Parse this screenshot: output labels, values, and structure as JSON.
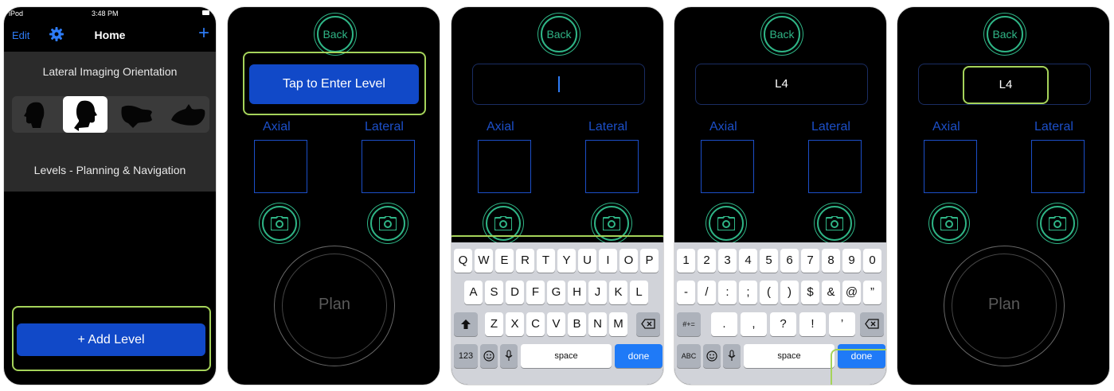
{
  "colors": {
    "accent_blue": "#1149c8",
    "link_blue": "#2e7cf6",
    "green": "#2fb586",
    "highlight": "#a5d35a",
    "label_blue": "#1c4fc8"
  },
  "screen1": {
    "status": {
      "carrier": "iPod",
      "time": "3:48 PM"
    },
    "nav": {
      "edit": "Edit",
      "title": "Home",
      "plus": "+",
      "settings_icon": "gear-icon"
    },
    "orientation_label": "Lateral Imaging Orientation",
    "orientation_options": [
      "head-left-icon",
      "head-right-icon",
      "head-down-icon",
      "head-up-icon"
    ],
    "orientation_selected": 2,
    "levels_label": "Levels - Planning & Navigation",
    "add_button": "+ Add Level"
  },
  "screen2": {
    "back": "Back",
    "tap_button": "Tap to Enter Level",
    "axial": "Axial",
    "lateral": "Lateral",
    "plan": "Plan"
  },
  "screen3": {
    "back": "Back",
    "axial": "Axial",
    "lateral": "Lateral",
    "keyboard": {
      "row1": [
        "Q",
        "W",
        "E",
        "R",
        "T",
        "Y",
        "U",
        "I",
        "O",
        "P"
      ],
      "row2": [
        "A",
        "S",
        "D",
        "F",
        "G",
        "H",
        "J",
        "K",
        "L"
      ],
      "row3": [
        "Z",
        "X",
        "C",
        "V",
        "B",
        "N",
        "M"
      ],
      "mode": "123",
      "space": "space",
      "done": "done"
    }
  },
  "screen4": {
    "back": "Back",
    "field_value": "L4",
    "axial": "Axial",
    "lateral": "Lateral",
    "keyboard": {
      "row1": [
        "1",
        "2",
        "3",
        "4",
        "5",
        "6",
        "7",
        "8",
        "9",
        "0"
      ],
      "row2": [
        "-",
        "/",
        ":",
        ";",
        "(",
        ")",
        "$",
        "&",
        "@",
        "”"
      ],
      "row3": [
        ".",
        ",",
        "?",
        "!",
        "’"
      ],
      "symbols": "#+=",
      "mode": "ABC",
      "space": "space",
      "done": "done"
    }
  },
  "screen5": {
    "back": "Back",
    "field_value": "L4",
    "axial": "Axial",
    "lateral": "Lateral",
    "plan": "Plan"
  }
}
